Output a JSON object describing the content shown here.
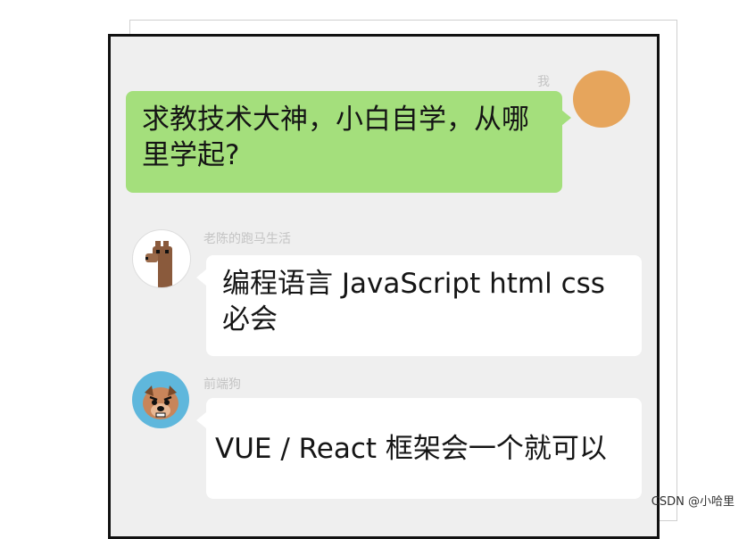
{
  "messages": [
    {
      "sender": "我",
      "text": "求教技术大神，小白自学，从哪里学起?",
      "avatar": "orange-circle-avatar"
    },
    {
      "sender": "老陈的跑马生活",
      "text": "编程语言 JavaScript  html css 必会",
      "avatar": "llama-avatar"
    },
    {
      "sender": "前端狗",
      "text": "VUE / React 框架会一个就可以",
      "avatar": "dog-face-avatar"
    }
  ],
  "watermark": "CSDN @小哈里",
  "colors": {
    "frame_bg": "#efefef",
    "my_bubble": "#a4df7c",
    "other_bubble": "#ffffff",
    "my_avatar": "#e6a55c",
    "dog_avatar_bg": "#5fb7dc"
  }
}
